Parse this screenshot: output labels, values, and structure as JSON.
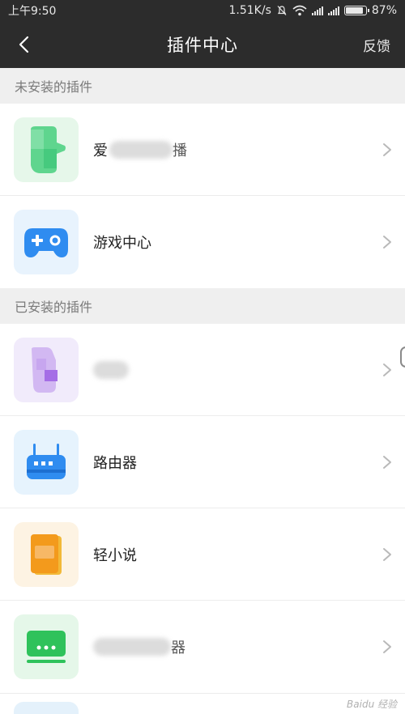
{
  "status": {
    "time": "上午9:50",
    "speed": "1.51K/s",
    "battery": "87%",
    "battery_level": 0.87
  },
  "nav": {
    "title": "插件中心",
    "feedback": "反馈",
    "back_icon": "chevron-left-icon"
  },
  "sections": {
    "uninstalled_title": "未安装的插件",
    "installed_title": "已安装的插件"
  },
  "uninstalled": [
    {
      "label": "爱",
      "icon": "aitv-icon",
      "tile_color": "#e6f7ea",
      "note_tail": "播"
    },
    {
      "label": "游戏中心",
      "icon": "gamepad-icon",
      "tile_color": "#e8f3fd"
    }
  ],
  "installed": [
    {
      "label": "",
      "icon": "purple-plugin-icon",
      "tile_color": "#f1ebfb"
    },
    {
      "label": "路由器",
      "icon": "router-icon",
      "tile_color": "#e6f3fd"
    },
    {
      "label": "轻小说",
      "icon": "book-icon",
      "tile_color": "#fdf3e3"
    },
    {
      "label": "",
      "icon": "tv-box-icon",
      "tile_color": "#e5f7e9",
      "note_tail": "器"
    }
  ],
  "watermark": "Baidu 经验",
  "colors": {
    "header_bg": "#2c2c2c",
    "section_bg": "#efefef",
    "chevron": "#b9b9b9"
  }
}
